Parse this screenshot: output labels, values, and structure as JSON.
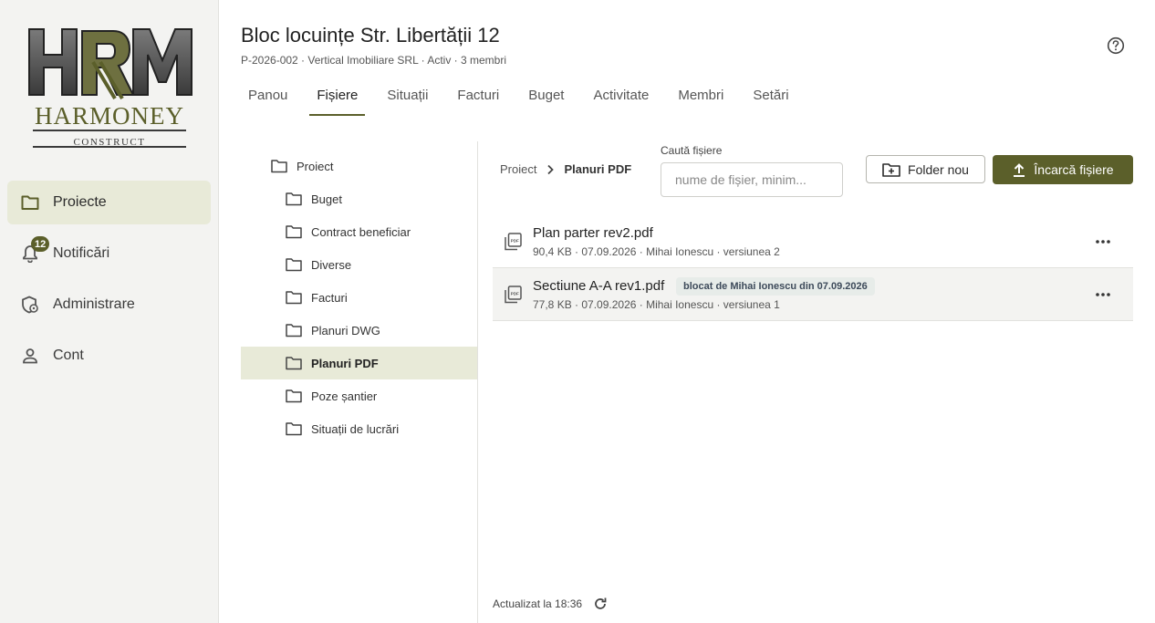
{
  "brand": {
    "name": "HARMONEY",
    "tagline": "CONSTRUCT",
    "monogram": "HRM",
    "color": "#5b5f2a"
  },
  "sidebar": {
    "items": [
      {
        "label": "Proiecte",
        "icon": "folder-icon",
        "active": true
      },
      {
        "label": "Notificări",
        "icon": "bell-icon",
        "badge": "12"
      },
      {
        "label": "Administrare",
        "icon": "shield-gear-icon"
      },
      {
        "label": "Cont",
        "icon": "person-icon"
      }
    ]
  },
  "header": {
    "title": "Bloc locuințe Str. Libertății 12",
    "subtitle": "P-2026-002 · Vertical Imobiliare SRL · Activ · 3 membri",
    "help_icon": "help-circle-icon"
  },
  "tabs": [
    {
      "label": "Panou"
    },
    {
      "label": "Fișiere",
      "active": true
    },
    {
      "label": "Situații"
    },
    {
      "label": "Facturi"
    },
    {
      "label": "Buget"
    },
    {
      "label": "Activitate"
    },
    {
      "label": "Membri"
    },
    {
      "label": "Setări"
    }
  ],
  "tree": {
    "root": "Proiect",
    "children": [
      "Buget",
      "Contract beneficiar",
      "Diverse",
      "Facturi",
      "Planuri DWG",
      "Planuri PDF",
      "Poze șantier",
      "Situații de lucrări"
    ],
    "selected": "Planuri PDF"
  },
  "breadcrumb": {
    "root": "Proiect",
    "current": "Planuri PDF"
  },
  "search": {
    "label": "Caută fișiere",
    "placeholder": "nume de fișier, minim..."
  },
  "buttons": {
    "new_folder": "Folder nou",
    "upload": "Încarcă fișiere"
  },
  "files": [
    {
      "name": "Plan parter rev2.pdf",
      "meta": "90,4 KB · 07.09.2026 · Mihai Ionescu · versiunea 2"
    },
    {
      "name": "Sectiune A-A rev1.pdf",
      "meta": "77,8 KB · 07.09.2026 · Mihai Ionescu · versiunea 1",
      "lock": "blocat de Mihai Ionescu din 07.09.2026"
    }
  ],
  "footer": {
    "updated": "Actualizat la 18:36"
  }
}
